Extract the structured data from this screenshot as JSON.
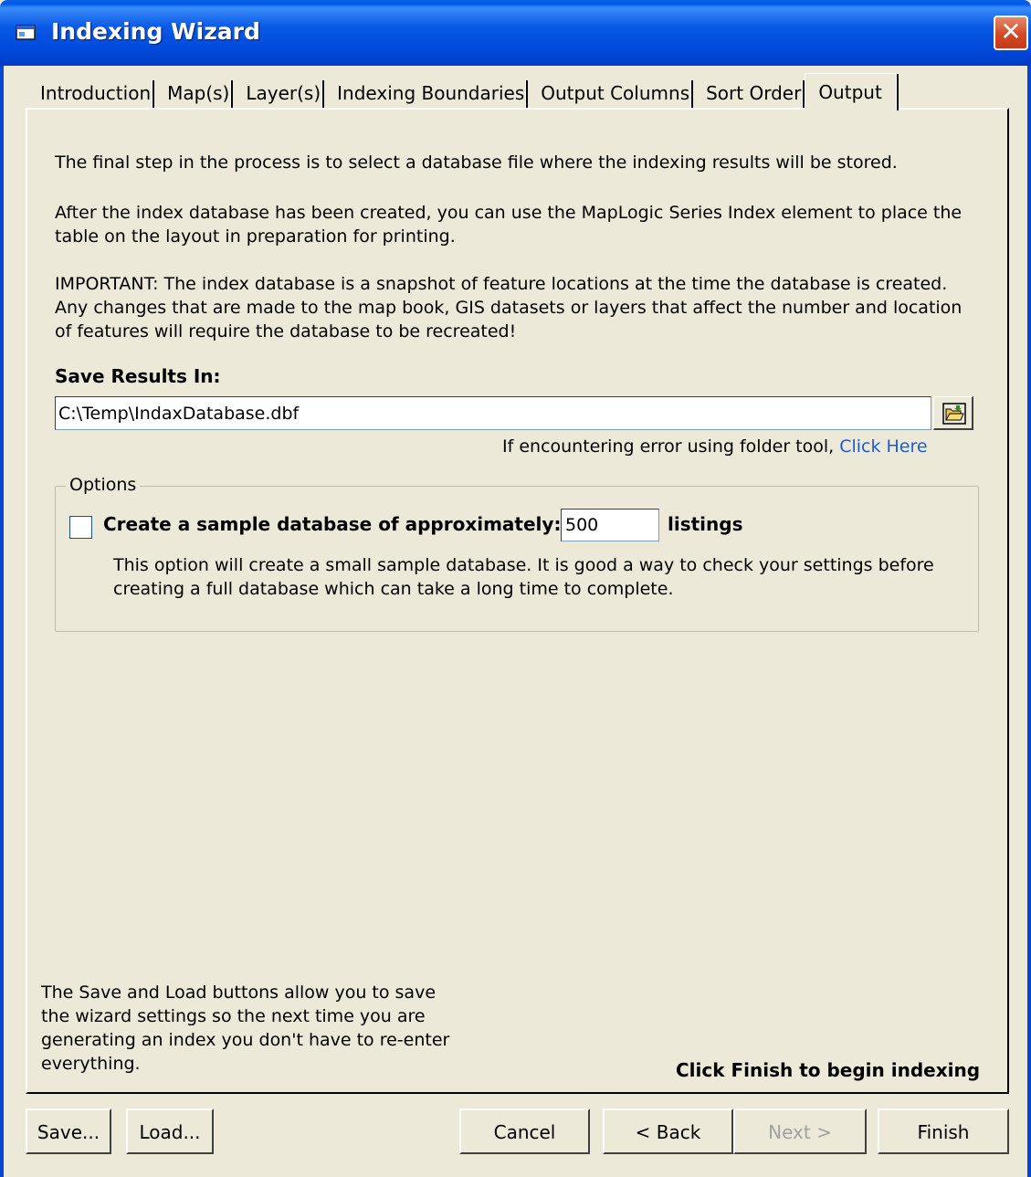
{
  "window": {
    "title": "Indexing Wizard",
    "close_glyph": "✕"
  },
  "tabs": [
    {
      "label": "Introduction"
    },
    {
      "label": "Map(s)"
    },
    {
      "label": "Layer(s)"
    },
    {
      "label": "Indexing Boundaries"
    },
    {
      "label": "Output Columns"
    },
    {
      "label": "Sort Order"
    },
    {
      "label": "Output",
      "active": true
    }
  ],
  "content": {
    "intro": "The final step in the process is to select a database file where the indexing results will be stored.",
    "after_created": "After the index database has been created, you can use the MapLogic Series Index element to place the table on the layout in preparation for printing.",
    "important": "IMPORTANT:  The index database is a snapshot of feature locations at the time the database is created. Any changes that are made to the map book, GIS datasets or layers that affect the number and location of features will require the database to be recreated!"
  },
  "save_results": {
    "label": "Save Results In:",
    "path_value": "C:\\Temp\\IndaxDatabase.dbf",
    "error_note": "If encountering error using folder tool,",
    "click_here": "Click Here"
  },
  "options": {
    "legend": "Options",
    "sample_label": "Create a sample database of approximately:",
    "sample_checked": false,
    "sample_count": "500",
    "listings_label": "listings",
    "note": "This option will create a small sample database.  It is good a way to check your settings before creating a full database which can take a long time to complete."
  },
  "footer": {
    "save_load_note": "The Save and Load buttons allow you to save the wizard settings so the next time you are generating an index you don't have to re-enter everything.",
    "finish_note": "Click Finish to begin indexing"
  },
  "buttons": {
    "save": "Save...",
    "load": "Load...",
    "cancel": "Cancel",
    "back": "< Back",
    "next": "Next >",
    "finish": "Finish"
  },
  "colors": {
    "titlebar": "#0047D8",
    "dialog_bg": "#ECE9D8",
    "link": "#1C5BD8",
    "disabled_text": "#A0A0A0"
  }
}
